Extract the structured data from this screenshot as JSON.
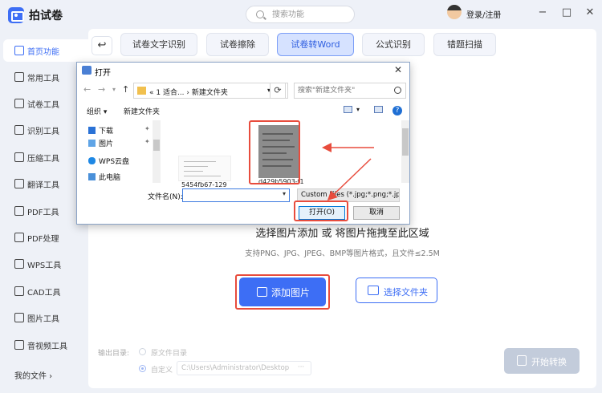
{
  "app": {
    "name": "拍试卷",
    "login": "登录/注册"
  },
  "search": {
    "placeholder": "搜索功能"
  },
  "window_controls": {
    "minimize": "−",
    "maximize": "□",
    "close": "✕"
  },
  "sidebar": {
    "items": [
      {
        "label": "首页功能",
        "icon": "home-icon",
        "active": true
      },
      {
        "label": "常用工具",
        "icon": "layers-icon"
      },
      {
        "label": "试卷工具",
        "icon": "exam-icon"
      },
      {
        "label": "识别工具",
        "icon": "scan-icon"
      },
      {
        "label": "压缩工具",
        "icon": "compress-icon"
      },
      {
        "label": "翻译工具",
        "icon": "translate-icon"
      },
      {
        "label": "PDF工具",
        "icon": "pdf-icon"
      },
      {
        "label": "PDF处理",
        "icon": "pdf-process-icon"
      },
      {
        "label": "WPS工具",
        "icon": "wps-icon"
      },
      {
        "label": "CAD工具",
        "icon": "cad-icon"
      },
      {
        "label": "图片工具",
        "icon": "image-icon"
      },
      {
        "label": "音视频工具",
        "icon": "video-icon"
      }
    ],
    "my_files": "我的文件 ›"
  },
  "tabs": [
    {
      "label": "试卷文字识别"
    },
    {
      "label": "试卷擦除"
    },
    {
      "label": "试卷转Word",
      "active": true
    },
    {
      "label": "公式识别"
    },
    {
      "label": "错题扫描"
    }
  ],
  "drop_zone": {
    "title": "选择图片添加 或 将图片拖拽至此区域",
    "subtitle": "支持PNG、JPG、JPEG、BMP等图片格式，且文件≤2.5M",
    "add_button": "添加图片",
    "folder_button": "选择文件夹"
  },
  "output": {
    "label": "输出目录:",
    "option_source": "原文件目录",
    "option_custom": "自定义",
    "custom_path": "C:\\Users\\Administrator\\Desktop",
    "path_more": "···",
    "convert_button": "开始转换"
  },
  "dialog": {
    "title": "打开",
    "close": "✕",
    "address": "« 1 适合... › 新建文件夹",
    "search_placeholder": "搜索\"新建文件夹\"",
    "organize": "组织 ▾",
    "new_folder": "新建文件夹",
    "tree": [
      {
        "label": "下载",
        "pinned": true
      },
      {
        "label": "图片",
        "pinned": true
      },
      {
        "label": "WPS云盘"
      },
      {
        "label": "此电脑"
      }
    ],
    "files": [
      {
        "name": "5454fb67-129"
      },
      {
        "name": "d429b5903-f1"
      }
    ],
    "filename_label": "文件名(N):",
    "filename_value": "",
    "filetype": "Custom Files (*.jpg;*.png;*.jp",
    "open_button": "打开(O)",
    "cancel_button": "取消"
  },
  "colors": {
    "accent": "#3d6ef5",
    "annotation": "#e84c3d"
  }
}
